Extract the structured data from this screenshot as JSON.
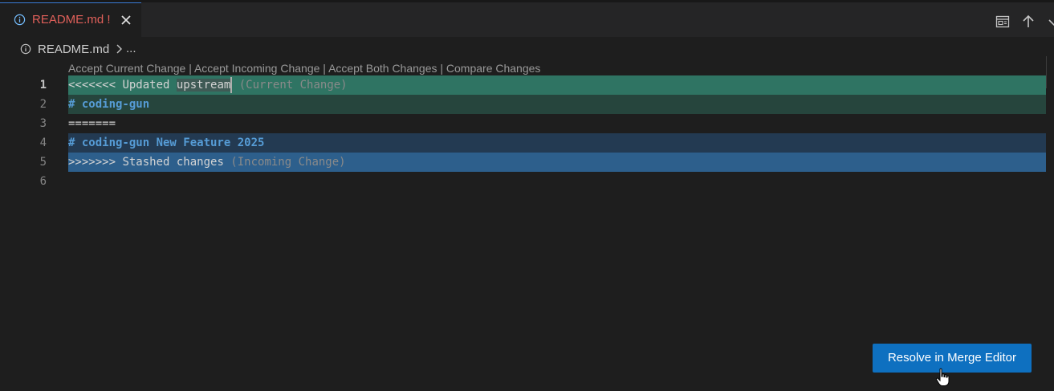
{
  "tab": {
    "title": "README.md",
    "modified_marker": "!",
    "icon": "info-icon",
    "close_icon": "close-icon"
  },
  "toolbar": {
    "icons": [
      "open-preview-icon",
      "arrow-up-icon",
      "chevron-down-icon"
    ]
  },
  "breadcrumb": {
    "icon": "info-icon",
    "file": "README.md",
    "separator_icon": "chevron-right-icon",
    "more": "..."
  },
  "codelens": {
    "accept_current": "Accept Current Change",
    "accept_incoming": "Accept Incoming Change",
    "accept_both": "Accept Both Changes",
    "compare": "Compare Changes",
    "separator": "|"
  },
  "editor": {
    "line_numbers": [
      "1",
      "2",
      "3",
      "4",
      "5",
      "6"
    ],
    "lines": {
      "l1_marker": "<<<<<<< ",
      "l1_pre": "Updated ",
      "l1_sel": "upstream",
      "l1_label": " (Current Change)",
      "l2": "# coding-gun",
      "l3": "=======",
      "l4": "# coding-gun New Feature 2025",
      "l5_marker": ">>>>>>> ",
      "l5_text": "Stashed changes",
      "l5_label": " (Incoming Change)",
      "l6": ""
    }
  },
  "merge_button": {
    "label": "Resolve in Merge Editor"
  },
  "colors": {
    "current_header": "#2f7463",
    "current_body": "#26453d",
    "incoming_body": "#233a52",
    "incoming_header": "#2d5f8c",
    "accent_button": "#0e70c0",
    "tab_title": "#e0605a"
  }
}
